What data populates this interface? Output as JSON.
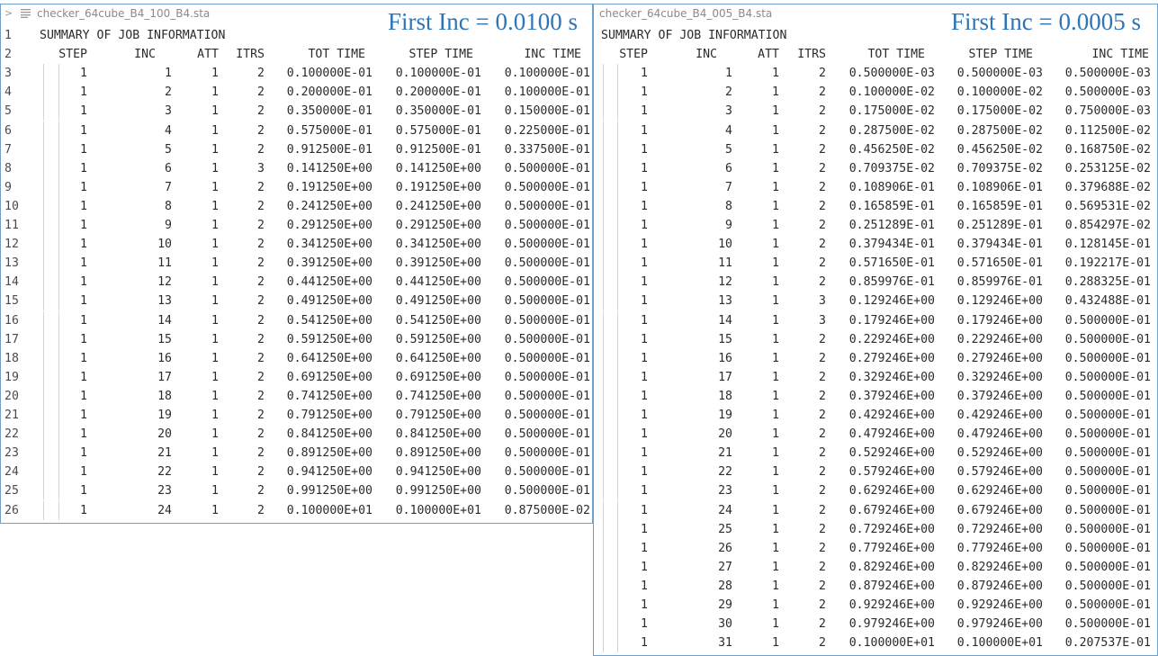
{
  "left": {
    "filename": "checker_64cube_B4_100_B4.sta",
    "title": "First Inc = 0.0100 s",
    "summary": "SUMMARY OF JOB INFORMATION",
    "headers": [
      "STEP",
      "INC",
      "ATT",
      "ITRS",
      "TOT TIME",
      "STEP TIME",
      "INC TIME"
    ],
    "line_numbers": [
      "1",
      "2",
      "3",
      "4",
      "5",
      "6",
      "7",
      "8",
      "9",
      "10",
      "11",
      "12",
      "13",
      "14",
      "15",
      "16",
      "17",
      "18",
      "19",
      "20",
      "21",
      "22",
      "23",
      "24",
      "25",
      "26"
    ],
    "rows": [
      [
        "1",
        "1",
        "1",
        "2",
        "0.100000E-01",
        "0.100000E-01",
        "0.100000E-01"
      ],
      [
        "1",
        "2",
        "1",
        "2",
        "0.200000E-01",
        "0.200000E-01",
        "0.100000E-01"
      ],
      [
        "1",
        "3",
        "1",
        "2",
        "0.350000E-01",
        "0.350000E-01",
        "0.150000E-01"
      ],
      [
        "1",
        "4",
        "1",
        "2",
        "0.575000E-01",
        "0.575000E-01",
        "0.225000E-01"
      ],
      [
        "1",
        "5",
        "1",
        "2",
        "0.912500E-01",
        "0.912500E-01",
        "0.337500E-01"
      ],
      [
        "1",
        "6",
        "1",
        "3",
        "0.141250E+00",
        "0.141250E+00",
        "0.500000E-01"
      ],
      [
        "1",
        "7",
        "1",
        "2",
        "0.191250E+00",
        "0.191250E+00",
        "0.500000E-01"
      ],
      [
        "1",
        "8",
        "1",
        "2",
        "0.241250E+00",
        "0.241250E+00",
        "0.500000E-01"
      ],
      [
        "1",
        "9",
        "1",
        "2",
        "0.291250E+00",
        "0.291250E+00",
        "0.500000E-01"
      ],
      [
        "1",
        "10",
        "1",
        "2",
        "0.341250E+00",
        "0.341250E+00",
        "0.500000E-01"
      ],
      [
        "1",
        "11",
        "1",
        "2",
        "0.391250E+00",
        "0.391250E+00",
        "0.500000E-01"
      ],
      [
        "1",
        "12",
        "1",
        "2",
        "0.441250E+00",
        "0.441250E+00",
        "0.500000E-01"
      ],
      [
        "1",
        "13",
        "1",
        "2",
        "0.491250E+00",
        "0.491250E+00",
        "0.500000E-01"
      ],
      [
        "1",
        "14",
        "1",
        "2",
        "0.541250E+00",
        "0.541250E+00",
        "0.500000E-01"
      ],
      [
        "1",
        "15",
        "1",
        "2",
        "0.591250E+00",
        "0.591250E+00",
        "0.500000E-01"
      ],
      [
        "1",
        "16",
        "1",
        "2",
        "0.641250E+00",
        "0.641250E+00",
        "0.500000E-01"
      ],
      [
        "1",
        "17",
        "1",
        "2",
        "0.691250E+00",
        "0.691250E+00",
        "0.500000E-01"
      ],
      [
        "1",
        "18",
        "1",
        "2",
        "0.741250E+00",
        "0.741250E+00",
        "0.500000E-01"
      ],
      [
        "1",
        "19",
        "1",
        "2",
        "0.791250E+00",
        "0.791250E+00",
        "0.500000E-01"
      ],
      [
        "1",
        "20",
        "1",
        "2",
        "0.841250E+00",
        "0.841250E+00",
        "0.500000E-01"
      ],
      [
        "1",
        "21",
        "1",
        "2",
        "0.891250E+00",
        "0.891250E+00",
        "0.500000E-01"
      ],
      [
        "1",
        "22",
        "1",
        "2",
        "0.941250E+00",
        "0.941250E+00",
        "0.500000E-01"
      ],
      [
        "1",
        "23",
        "1",
        "2",
        "0.991250E+00",
        "0.991250E+00",
        "0.500000E-01"
      ],
      [
        "1",
        "24",
        "1",
        "2",
        "0.100000E+01",
        "0.100000E+01",
        "0.875000E-02"
      ]
    ]
  },
  "right": {
    "filename": "checker_64cube_B4_005_B4.sta",
    "title": "First Inc = 0.0005 s",
    "summary": "SUMMARY OF JOB INFORMATION",
    "headers": [
      "STEP",
      "INC",
      "ATT",
      "ITRS",
      "TOT TIME",
      "STEP TIME",
      "INC TIME"
    ],
    "rows": [
      [
        "1",
        "1",
        "1",
        "2",
        "0.500000E-03",
        "0.500000E-03",
        "0.500000E-03"
      ],
      [
        "1",
        "2",
        "1",
        "2",
        "0.100000E-02",
        "0.100000E-02",
        "0.500000E-03"
      ],
      [
        "1",
        "3",
        "1",
        "2",
        "0.175000E-02",
        "0.175000E-02",
        "0.750000E-03"
      ],
      [
        "1",
        "4",
        "1",
        "2",
        "0.287500E-02",
        "0.287500E-02",
        "0.112500E-02"
      ],
      [
        "1",
        "5",
        "1",
        "2",
        "0.456250E-02",
        "0.456250E-02",
        "0.168750E-02"
      ],
      [
        "1",
        "6",
        "1",
        "2",
        "0.709375E-02",
        "0.709375E-02",
        "0.253125E-02"
      ],
      [
        "1",
        "7",
        "1",
        "2",
        "0.108906E-01",
        "0.108906E-01",
        "0.379688E-02"
      ],
      [
        "1",
        "8",
        "1",
        "2",
        "0.165859E-01",
        "0.165859E-01",
        "0.569531E-02"
      ],
      [
        "1",
        "9",
        "1",
        "2",
        "0.251289E-01",
        "0.251289E-01",
        "0.854297E-02"
      ],
      [
        "1",
        "10",
        "1",
        "2",
        "0.379434E-01",
        "0.379434E-01",
        "0.128145E-01"
      ],
      [
        "1",
        "11",
        "1",
        "2",
        "0.571650E-01",
        "0.571650E-01",
        "0.192217E-01"
      ],
      [
        "1",
        "12",
        "1",
        "2",
        "0.859976E-01",
        "0.859976E-01",
        "0.288325E-01"
      ],
      [
        "1",
        "13",
        "1",
        "3",
        "0.129246E+00",
        "0.129246E+00",
        "0.432488E-01"
      ],
      [
        "1",
        "14",
        "1",
        "3",
        "0.179246E+00",
        "0.179246E+00",
        "0.500000E-01"
      ],
      [
        "1",
        "15",
        "1",
        "2",
        "0.229246E+00",
        "0.229246E+00",
        "0.500000E-01"
      ],
      [
        "1",
        "16",
        "1",
        "2",
        "0.279246E+00",
        "0.279246E+00",
        "0.500000E-01"
      ],
      [
        "1",
        "17",
        "1",
        "2",
        "0.329246E+00",
        "0.329246E+00",
        "0.500000E-01"
      ],
      [
        "1",
        "18",
        "1",
        "2",
        "0.379246E+00",
        "0.379246E+00",
        "0.500000E-01"
      ],
      [
        "1",
        "19",
        "1",
        "2",
        "0.429246E+00",
        "0.429246E+00",
        "0.500000E-01"
      ],
      [
        "1",
        "20",
        "1",
        "2",
        "0.479246E+00",
        "0.479246E+00",
        "0.500000E-01"
      ],
      [
        "1",
        "21",
        "1",
        "2",
        "0.529246E+00",
        "0.529246E+00",
        "0.500000E-01"
      ],
      [
        "1",
        "22",
        "1",
        "2",
        "0.579246E+00",
        "0.579246E+00",
        "0.500000E-01"
      ],
      [
        "1",
        "23",
        "1",
        "2",
        "0.629246E+00",
        "0.629246E+00",
        "0.500000E-01"
      ],
      [
        "1",
        "24",
        "1",
        "2",
        "0.679246E+00",
        "0.679246E+00",
        "0.500000E-01"
      ],
      [
        "1",
        "25",
        "1",
        "2",
        "0.729246E+00",
        "0.729246E+00",
        "0.500000E-01"
      ],
      [
        "1",
        "26",
        "1",
        "2",
        "0.779246E+00",
        "0.779246E+00",
        "0.500000E-01"
      ],
      [
        "1",
        "27",
        "1",
        "2",
        "0.829246E+00",
        "0.829246E+00",
        "0.500000E-01"
      ],
      [
        "1",
        "28",
        "1",
        "2",
        "0.879246E+00",
        "0.879246E+00",
        "0.500000E-01"
      ],
      [
        "1",
        "29",
        "1",
        "2",
        "0.929246E+00",
        "0.929246E+00",
        "0.500000E-01"
      ],
      [
        "1",
        "30",
        "1",
        "2",
        "0.979246E+00",
        "0.979246E+00",
        "0.500000E-01"
      ],
      [
        "1",
        "31",
        "1",
        "2",
        "0.100000E+01",
        "0.100000E+01",
        "0.207537E-01"
      ]
    ]
  }
}
